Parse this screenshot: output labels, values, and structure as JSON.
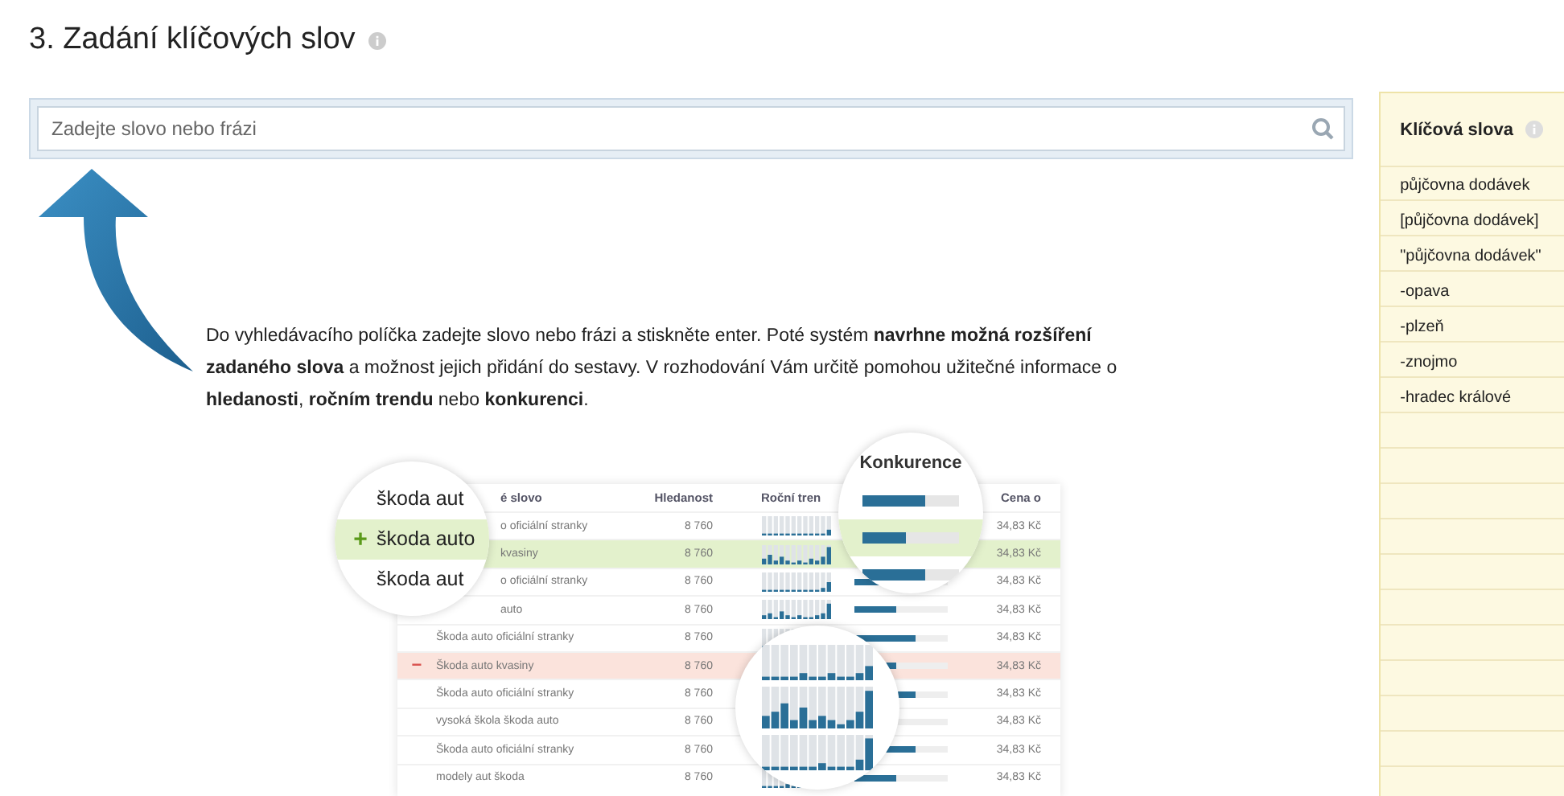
{
  "title": "3. Zadání klíčových slov",
  "search": {
    "placeholder": "Zadejte slovo nebo frázi"
  },
  "description": "Do vyhledávacího políčka zadejte slovo nebo frázi a stiskněte enter. Poté systém **navrhne možná rozšíření zadaného slova** a možnost jejich přidání do sestavy. V rozhodování Vám určitě pomohou užitečné informace o **hledanosti**, **ročním trendu** nebo **konkurenci**.",
  "illustration": {
    "columns": [
      "é slovo",
      "Hledanost",
      "Roční tren",
      "Cena o"
    ],
    "rows": [
      {
        "keyword": "o oficiální stranky",
        "searches": "8 760",
        "price": "34,83 Kč",
        "level": 0.65,
        "kind": "normal"
      },
      {
        "keyword": "kvasiny",
        "searches": "8 760",
        "price": "34,83 Kč",
        "level": 0.45,
        "kind": "added"
      },
      {
        "keyword": "o oficiální stranky",
        "searches": "8 760",
        "price": "34,83 Kč",
        "level": 0.62,
        "kind": "normal"
      },
      {
        "keyword": "auto",
        "searches": "8 760",
        "price": "34,83 Kč",
        "level": 0.45,
        "kind": "normal"
      },
      {
        "keyword": "Škoda auto oficiální stranky",
        "searches": "8 760",
        "price": "34,83 Kč",
        "level": 0.65,
        "kind": "normal"
      },
      {
        "keyword": "Škoda auto kvasiny",
        "searches": "8 760",
        "price": "34,83 Kč",
        "level": 0.45,
        "kind": "removed",
        "icon": "−"
      },
      {
        "keyword": "Škoda auto oficiální stranky",
        "searches": "8 760",
        "price": "34,83 Kč",
        "level": 0.65,
        "kind": "normal"
      },
      {
        "keyword": "vysoká škola škoda auto",
        "searches": "8 760",
        "price": "34,83 Kč",
        "level": 0.45,
        "kind": "normal"
      },
      {
        "keyword": "Škoda auto oficiální stranky",
        "searches": "8 760",
        "price": "34,83 Kč",
        "level": 0.65,
        "kind": "normal"
      },
      {
        "keyword": "modely aut škoda",
        "searches": "8 760",
        "price": "34,83 Kč",
        "level": 0.45,
        "kind": "normal"
      }
    ],
    "magnifier": [
      {
        "label": "škoda aut",
        "kind": "normal"
      },
      {
        "label": "škoda auto",
        "kind": "added",
        "icon": "+"
      },
      {
        "label": "škoda aut",
        "kind": "normal"
      }
    ],
    "competition_zoom": {
      "title": "Konkurence",
      "bars": [
        {
          "level": 0.65,
          "kind": "normal"
        },
        {
          "level": 0.45,
          "kind": "added"
        },
        {
          "level": 0.65,
          "kind": "normal"
        }
      ]
    }
  },
  "keywords": {
    "title": "Klíčová slova",
    "items": [
      "půjčovna dodávek",
      "[půjčovna dodávek]",
      "\"půjčovna dodávek\"",
      "-opava",
      "-plzeň",
      "-znojmo",
      "-hradec králové"
    ]
  }
}
